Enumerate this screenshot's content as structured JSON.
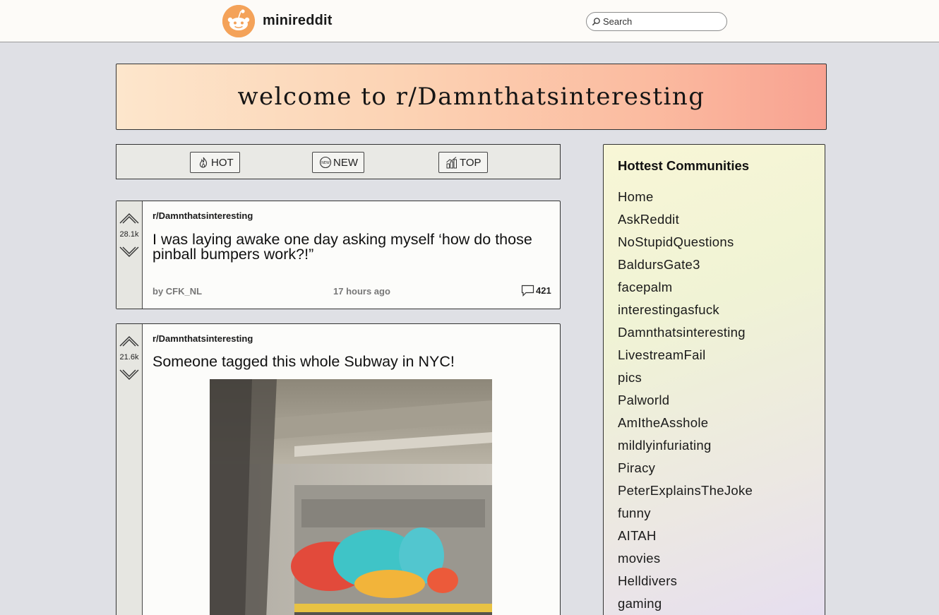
{
  "header": {
    "brand": "minireddit",
    "search_placeholder": "Search"
  },
  "banner": {
    "title": "welcome to r/Damnthatsinteresting"
  },
  "sort": {
    "hot": "HOT",
    "new": "NEW",
    "top": "TOP"
  },
  "posts": [
    {
      "subreddit": "r/Damnthatsinteresting",
      "votes": "28.1k",
      "title": "I was laying awake one day asking myself ‘how do those pinball bumpers work?!”",
      "author": "by CFK_NL",
      "time": "17 hours ago",
      "comments": "421"
    },
    {
      "subreddit": "r/Damnthatsinteresting",
      "votes": "21.6k",
      "title": "Someone tagged this whole Subway in NYC!"
    }
  ],
  "sidebar": {
    "title": "Hottest Communities",
    "communities": [
      "Home",
      "AskReddit",
      "NoStupidQuestions",
      "BaldursGate3",
      "facepalm",
      "interestingasfuck",
      "Damnthatsinteresting",
      "LivestreamFail",
      "pics",
      "Palworld",
      "AmItheAsshole",
      "mildlyinfuriating",
      "Piracy",
      "PeterExplainsTheJoke",
      "funny",
      "AITAH",
      "movies",
      "Helldivers",
      "gaming"
    ]
  },
  "colors": {
    "logo": "#f4a259",
    "banner_start": "#fde6cc",
    "banner_end": "#f8a291"
  }
}
